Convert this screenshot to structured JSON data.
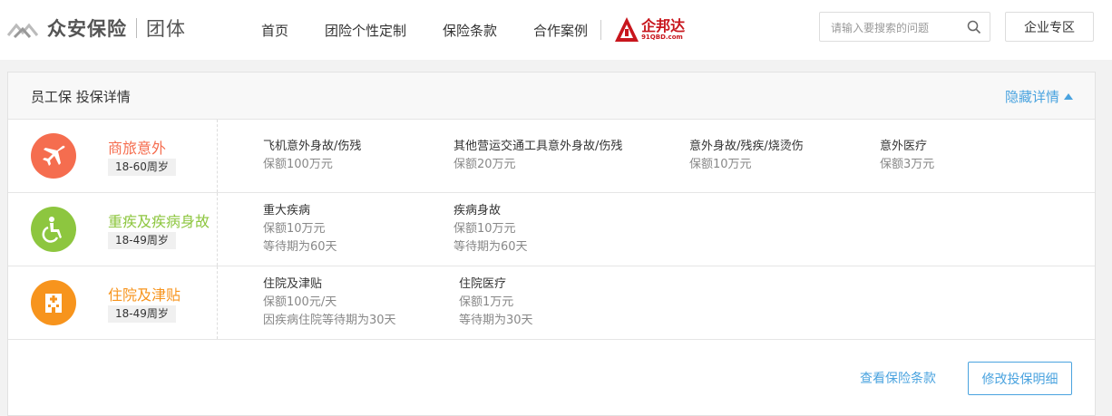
{
  "header": {
    "logo_text": "众安保险",
    "logo_sub": "团体",
    "nav": [
      "首页",
      "团险个性定制",
      "保险条款",
      "合作案例"
    ],
    "partner": {
      "name": "企邦达",
      "url": "91QBD.com"
    },
    "search_placeholder": "请输入要搜索的问题",
    "enterprise_label": "企业专区"
  },
  "panel": {
    "title": "员工保 投保详情",
    "toggle_label": "隐藏详情",
    "rows": [
      {
        "name": "商旅意外",
        "age": "18-60周岁",
        "color": "#f56d4f",
        "icon": "airplane-icon",
        "items": [
          {
            "name": "飞机意外身故/伤残",
            "amount": "保额100万元"
          },
          {
            "name": "其他营运交通工具意外身故/伤残",
            "amount": "保额20万元"
          },
          {
            "name": "意外身故/残疾/烧烫伤",
            "amount": "保额10万元"
          },
          {
            "name": "意外医疗",
            "amount": "保额3万元"
          }
        ]
      },
      {
        "name": "重疾及疾病身故",
        "age": "18-49周岁",
        "color": "#8dc63f",
        "icon": "wheelchair-icon",
        "items": [
          {
            "name": "重大疾病",
            "amount": "保额10万元",
            "wait": "等待期为60天"
          },
          {
            "name": "疾病身故",
            "amount": "保额10万元",
            "wait": "等待期为60天"
          }
        ]
      },
      {
        "name": "住院及津贴",
        "age": "18-49周岁",
        "color": "#f7941d",
        "icon": "hospital-icon",
        "items": [
          {
            "name": "住院及津贴",
            "amount": "保额100元/天",
            "wait": "因疾病住院等待期为30天"
          },
          {
            "name": "住院医疗",
            "amount": "保额1万元",
            "wait": "等待期为30天"
          }
        ]
      }
    ],
    "view_terms": "查看保险条款",
    "modify_label": "修改投保明细"
  }
}
